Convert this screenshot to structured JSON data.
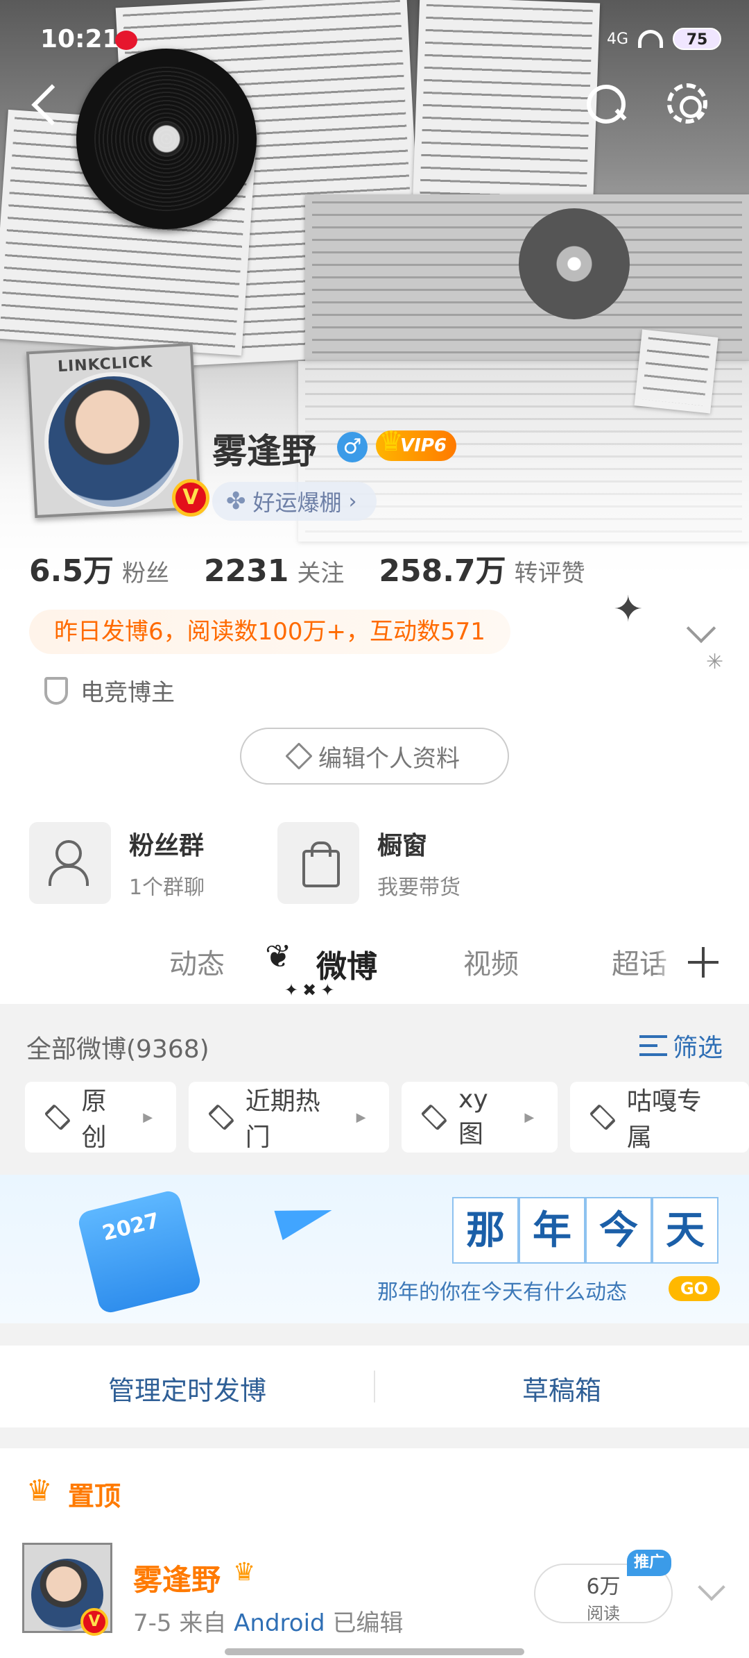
{
  "status_bar": {
    "time": "10:21",
    "battery": "75",
    "network": "4G"
  },
  "profile": {
    "name": "雾逢野",
    "vip_label": "VIP6",
    "avatar_frame_text": "LINKCLICK",
    "avatar_badge": "V",
    "gender_symbol": "♂",
    "luck_tag": "好运爆棚",
    "luck_chevron": "›",
    "stats": [
      {
        "value": "6.5万",
        "label": "粉丝"
      },
      {
        "value": "2231",
        "label": "关注"
      },
      {
        "value": "258.7万",
        "label": "转评赞"
      }
    ],
    "activity": "昨日发博6，阅读数100万+，互动数571",
    "tag": "电竞博主",
    "edit_button": "编辑个人资料"
  },
  "features": [
    {
      "title": "粉丝群",
      "subtitle": "1个群聊",
      "icon": "users-icon"
    },
    {
      "title": "橱窗",
      "subtitle": "我要带货",
      "icon": "bag-icon"
    }
  ],
  "tabs": [
    {
      "label": "动态",
      "active": false
    },
    {
      "label": "微博",
      "active": true
    },
    {
      "label": "视频",
      "active": false
    },
    {
      "label": "超话",
      "active": false
    }
  ],
  "tab_marker": "✦✖✦",
  "feed": {
    "all_count": "全部微博(9368)",
    "filter_label": "筛选",
    "chips": [
      "原创",
      "近期热门",
      "xy图",
      "咕嘎专属"
    ]
  },
  "banner": {
    "chars": [
      "那",
      "年",
      "今",
      "天"
    ],
    "subtitle": "那年的你在今天有什么动态",
    "go": "GO",
    "calendar_year": "2027"
  },
  "schedule": {
    "left": "管理定时发博",
    "right": "草稿箱"
  },
  "pinned": {
    "label": "置顶",
    "author": "雾逢野",
    "date": "7-5",
    "from": "来自",
    "source": "Android",
    "edited": "已编辑",
    "reads_value": "6万",
    "reads_label": "阅读",
    "promo": "推广"
  },
  "colors": {
    "accent_orange": "#ff7a00",
    "link_blue": "#2f6fb5",
    "vip_gold": "#ffb400"
  }
}
